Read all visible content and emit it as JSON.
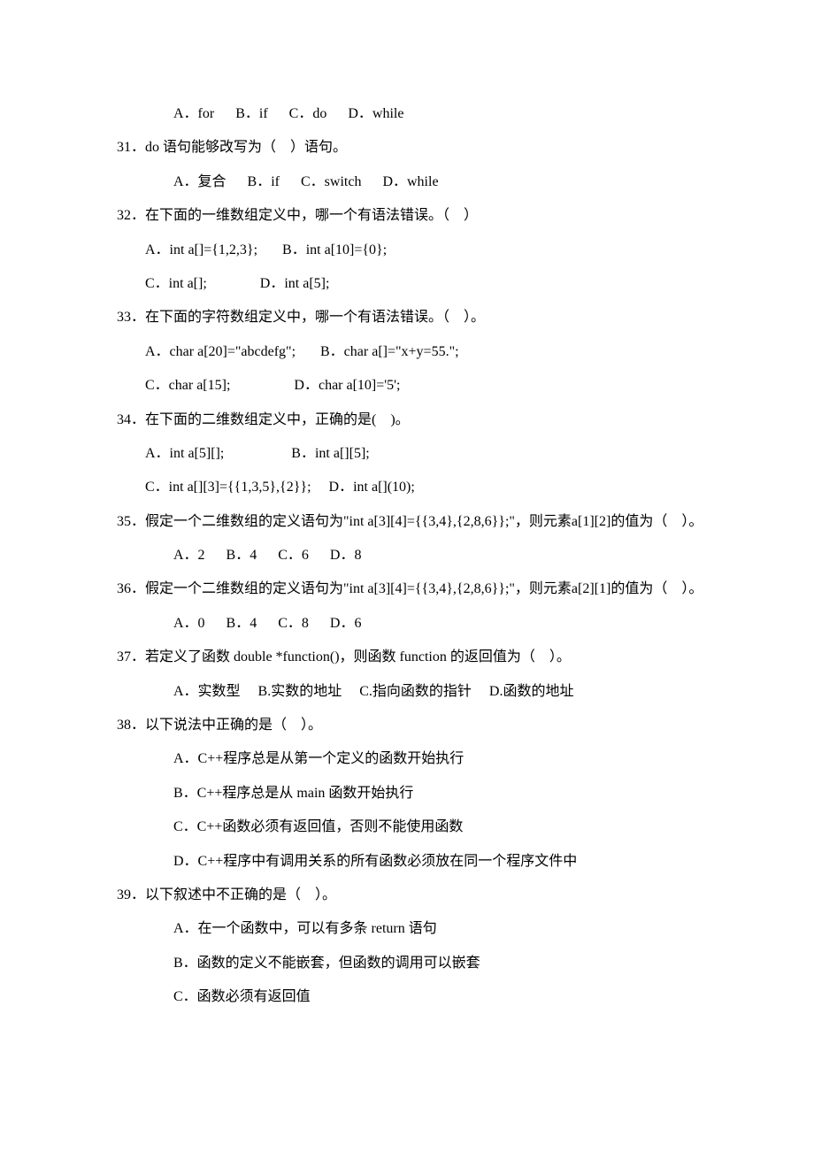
{
  "lines": [
    {
      "cls": "indent3",
      "text": "A．for      B．if      C．do      D．while"
    },
    {
      "cls": "indent1",
      "text": "31．do 语句能够改写为（    ）语句。"
    },
    {
      "cls": "indent3",
      "text": "A．复合      B．if      C．switch      D．while"
    },
    {
      "cls": "indent1",
      "text": "32．在下面的一维数组定义中，哪一个有语法错误。（    ）"
    },
    {
      "cls": "indent2",
      "text": "A．int a[]={1,2,3};       B．int a[10]={0};"
    },
    {
      "cls": "indent2",
      "text": "C．int a[];               D．int a[5];"
    },
    {
      "cls": "indent1",
      "text": "33．在下面的字符数组定义中，哪一个有语法错误。（    ）。"
    },
    {
      "cls": "indent2",
      "text": "A．char a[20]=\"abcdefg\";       B．char a[]=\"x+y=55.\";"
    },
    {
      "cls": "indent2",
      "text": "C．char a[15];                  D．char a[10]='5';"
    },
    {
      "cls": "indent1",
      "text": "34．在下面的二维数组定义中，正确的是(    )。"
    },
    {
      "cls": "indent2",
      "text": "A．int a[5][];                   B．int a[][5];"
    },
    {
      "cls": "indent2",
      "text": "C．int a[][3]={{1,3,5},{2}};     D．int a[](10);"
    },
    {
      "cls": "indent1",
      "text": "35．假定一个二维数组的定义语句为\"int a[3][4]={{3,4},{2,8,6}};\"，则元素a[1][2]的值为（    ）。"
    },
    {
      "cls": "indent3",
      "text": "A．2      B．4      C．6      D．8"
    },
    {
      "cls": "indent1",
      "text": "36．假定一个二维数组的定义语句为\"int a[3][4]={{3,4},{2,8,6}};\"，则元素a[2][1]的值为（    ）。"
    },
    {
      "cls": "indent3",
      "text": "A．0      B．4      C．8      D．6"
    },
    {
      "cls": "indent1",
      "text": "37．若定义了函数 double *function()，则函数 function 的返回值为（    ）。"
    },
    {
      "cls": "indent3",
      "text": "A．实数型     B.实数的地址     C.指向函数的指针     D.函数的地址"
    },
    {
      "cls": "indent1",
      "text": "38．以下说法中正确的是（    ）。"
    },
    {
      "cls": "indent3",
      "text": "A．C++程序总是从第一个定义的函数开始执行"
    },
    {
      "cls": "indent3",
      "text": "B．C++程序总是从 main 函数开始执行"
    },
    {
      "cls": "indent3",
      "text": "C．C++函数必须有返回值，否则不能使用函数"
    },
    {
      "cls": "indent3",
      "text": "D．C++程序中有调用关系的所有函数必须放在同一个程序文件中"
    },
    {
      "cls": "indent1",
      "text": "39．以下叙述中不正确的是（    ）。"
    },
    {
      "cls": "indent3",
      "text": "A．在一个函数中，可以有多条 return 语句"
    },
    {
      "cls": "indent3",
      "text": "B．函数的定义不能嵌套，但函数的调用可以嵌套"
    },
    {
      "cls": "indent3",
      "text": "C．函数必须有返回值"
    }
  ]
}
